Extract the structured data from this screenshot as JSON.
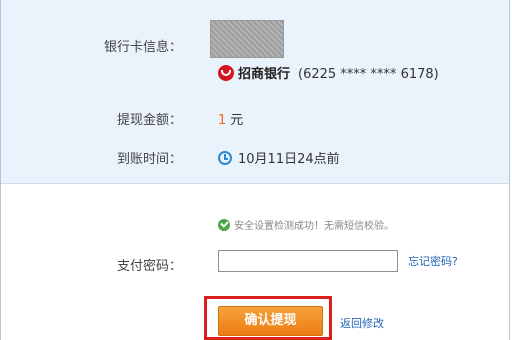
{
  "card_info": {
    "label": "银行卡信息：",
    "bank_name": "招商银行",
    "card_number": "(6225 **** **** 6178)"
  },
  "amount": {
    "label": "提现金额：",
    "value": "1",
    "unit": "元"
  },
  "arrival": {
    "label": "到账时间：",
    "value": "10月11日24点前"
  },
  "security": {
    "note": "安全设置检测成功！无需短信校验。"
  },
  "password": {
    "label": "支付密码：",
    "value": "",
    "forgot_link": "忘记密码?"
  },
  "actions": {
    "confirm_label": "确认提现",
    "back_label": "返回修改"
  },
  "colors": {
    "accent_orange": "#ec7d12",
    "link_blue": "#2563b8",
    "amount_orange": "#f26b17",
    "highlight_red": "#d9201c"
  }
}
